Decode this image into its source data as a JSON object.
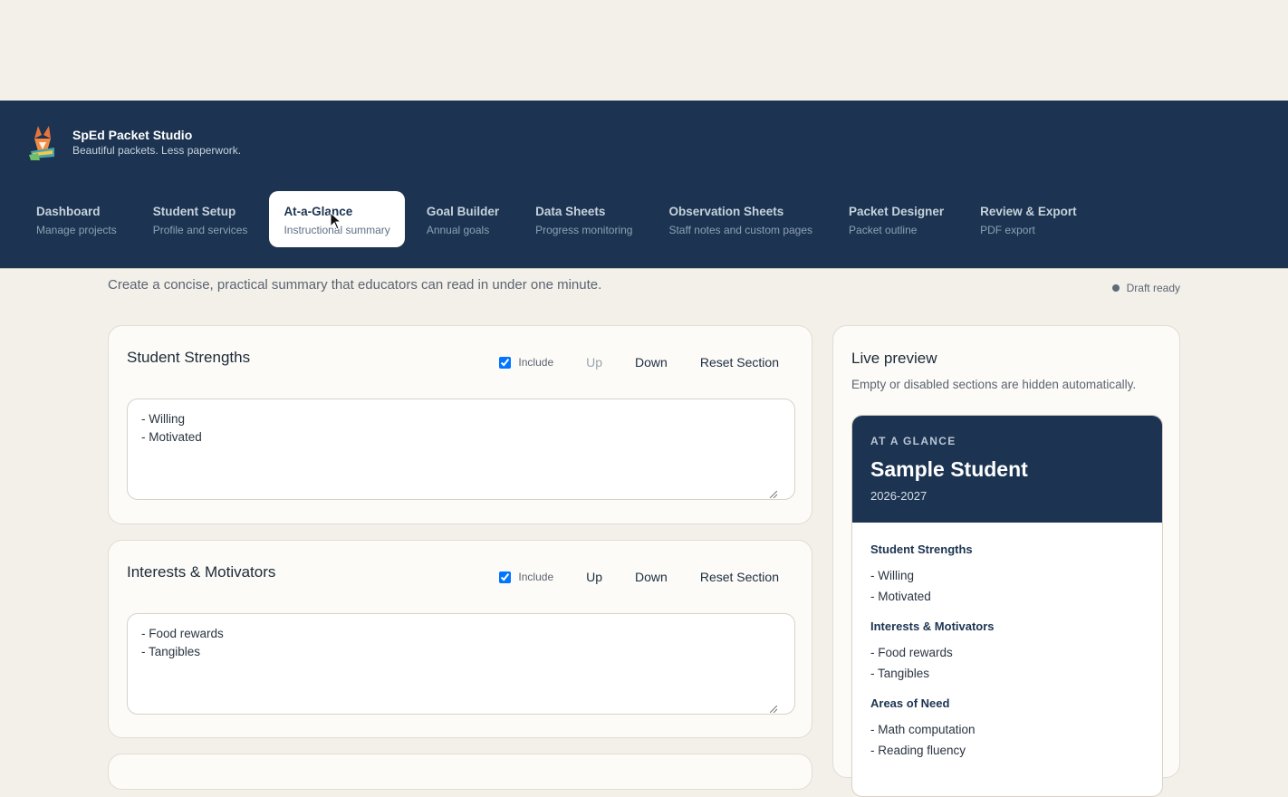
{
  "app": {
    "name": "SpEd Packet Studio",
    "tagline": "Beautiful packets. Less paperwork."
  },
  "tabs": [
    {
      "label": "Dashboard",
      "sub": "Manage projects"
    },
    {
      "label": "Student Setup",
      "sub": "Profile and services"
    },
    {
      "label": "At-a-Glance",
      "sub": "Instructional summary",
      "active": true
    },
    {
      "label": "Goal Builder",
      "sub": "Annual goals"
    },
    {
      "label": "Data Sheets",
      "sub": "Progress monitoring"
    },
    {
      "label": "Observation Sheets",
      "sub": "Staff notes and custom pages"
    },
    {
      "label": "Packet Designer",
      "sub": "Packet outline"
    },
    {
      "label": "Review & Export",
      "sub": "PDF export"
    }
  ],
  "page": {
    "intro": "Create a concise, practical summary that educators can read in under one minute.",
    "status": "Draft ready"
  },
  "sections": [
    {
      "title": "Student Strengths",
      "include_label": "Include",
      "included": true,
      "up": "Up",
      "up_disabled": true,
      "down": "Down",
      "reset": "Reset Section",
      "text": "- Willing\n- Motivated"
    },
    {
      "title": "Interests & Motivators",
      "include_label": "Include",
      "included": true,
      "up": "Up",
      "up_disabled": false,
      "down": "Down",
      "reset": "Reset Section",
      "text": "- Food rewards\n- Tangibles"
    }
  ],
  "preview": {
    "title": "Live preview",
    "subtitle": "Empty or disabled sections are hidden automatically.",
    "kicker": "AT A GLANCE",
    "student_name": "Sample Student",
    "year": "2026-2027",
    "sections": [
      {
        "title": "Student Strengths",
        "lines": [
          "- Willing",
          "- Motivated"
        ]
      },
      {
        "title": "Interests & Motivators",
        "lines": [
          "- Food rewards",
          "- Tangibles"
        ]
      },
      {
        "title": "Areas of Need",
        "lines": [
          "- Math computation",
          "- Reading fluency"
        ]
      }
    ]
  },
  "colors": {
    "navy": "#1c3451",
    "page_bg": "#f3f0ea",
    "card_bg": "#fcfbf7"
  }
}
